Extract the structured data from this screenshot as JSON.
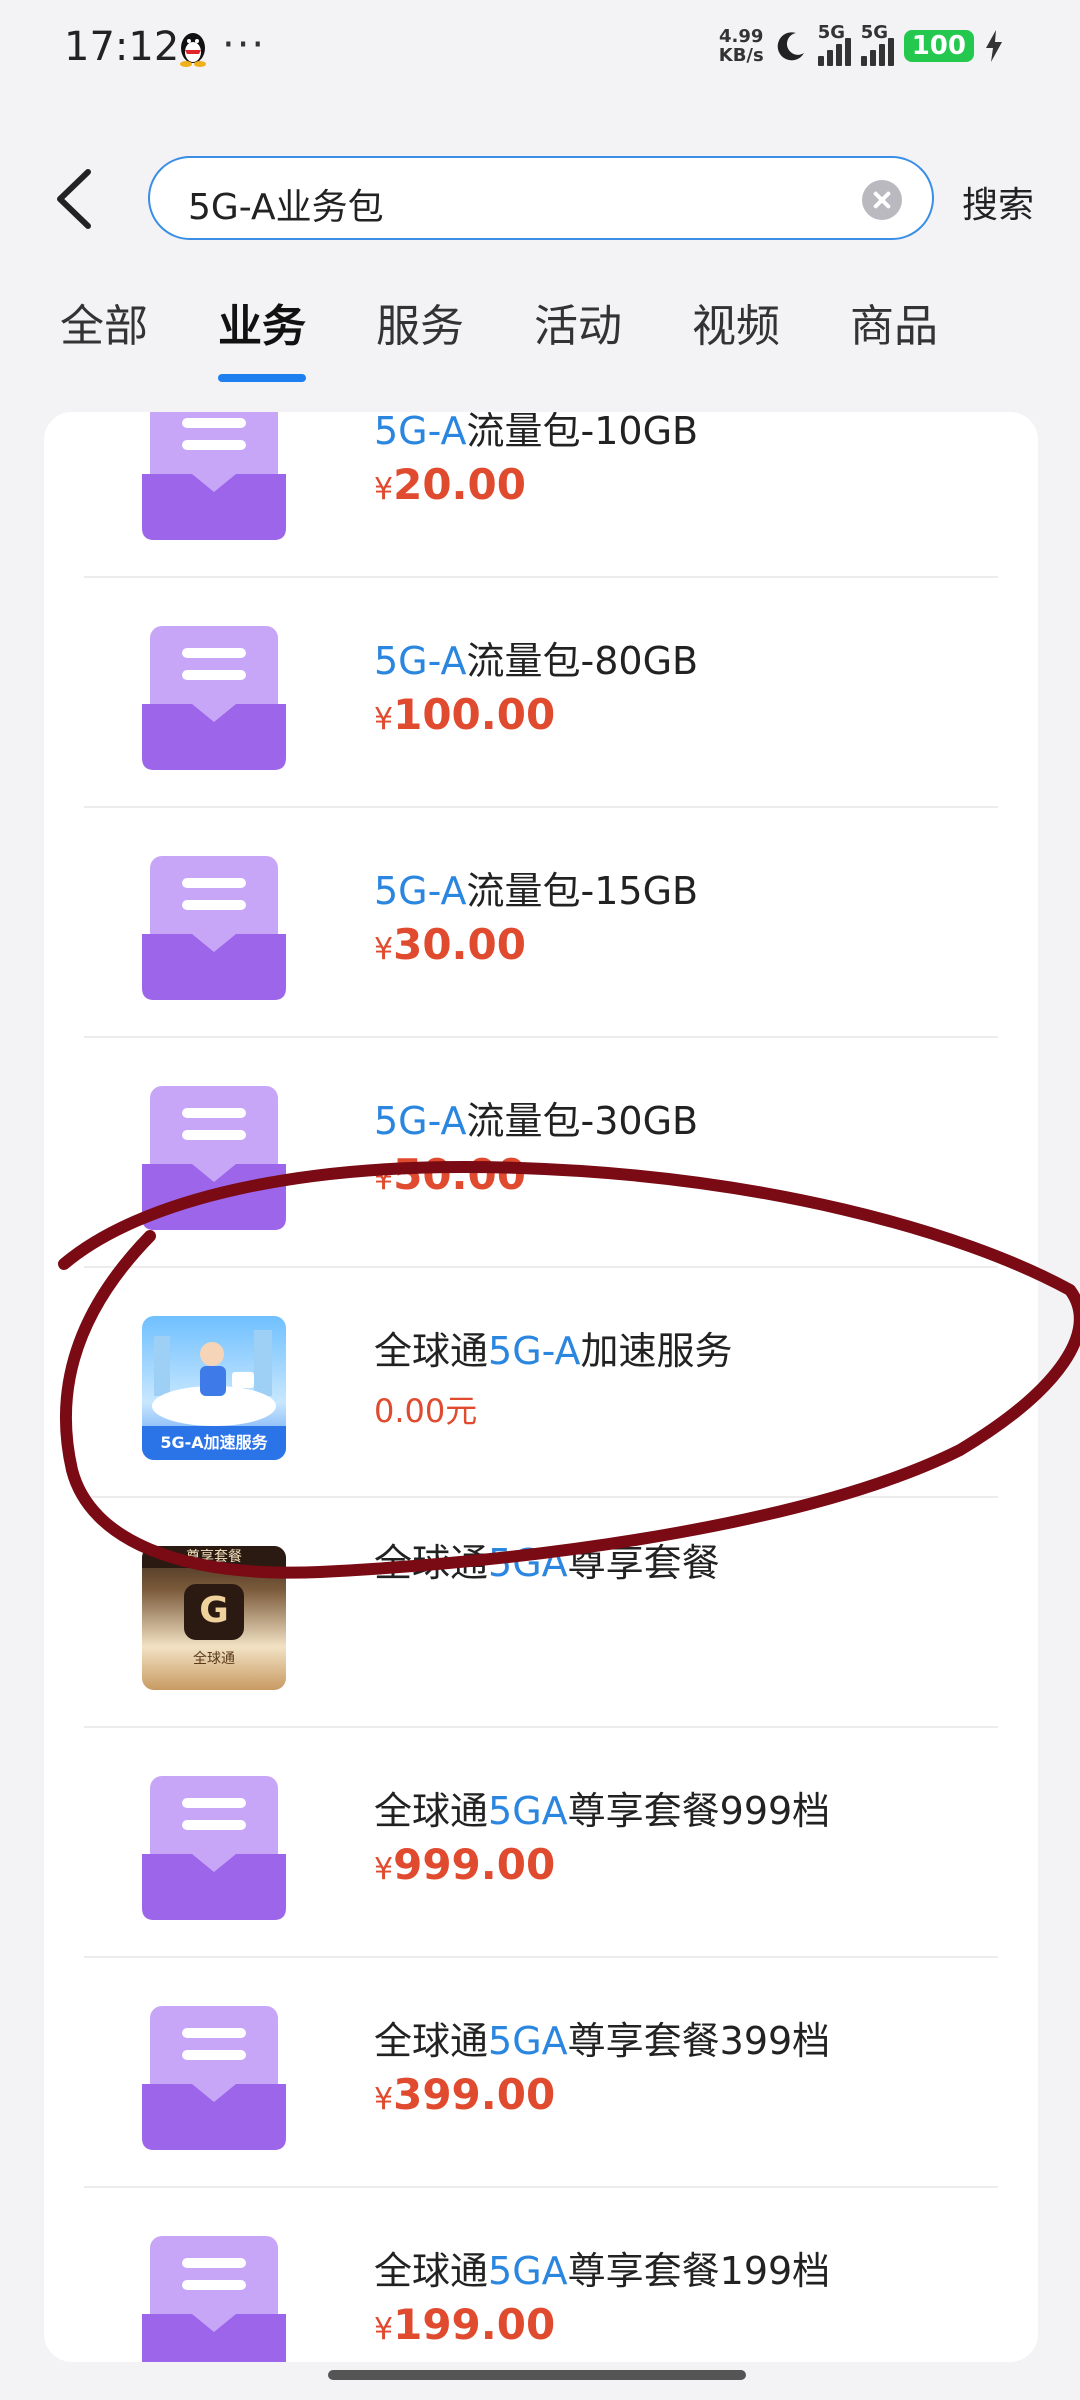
{
  "status_bar": {
    "time": "17:12",
    "speed_value": "4.99",
    "speed_unit": "KB/s",
    "sim1": "5G",
    "sim2": "5G",
    "battery": "100"
  },
  "search": {
    "query": "5G-A业务包",
    "button": "搜索"
  },
  "tabs": [
    "全部",
    "业务",
    "服务",
    "活动",
    "视频",
    "商品"
  ],
  "active_tab": "业务",
  "results": [
    {
      "title_hl": "5G-A",
      "title_rest": "流量包-10GB",
      "currency": "¥",
      "price": "20.00"
    },
    {
      "title_hl": "5G-A",
      "title_rest": "流量包-80GB",
      "currency": "¥",
      "price": "100.00"
    },
    {
      "title_hl": "5G-A",
      "title_rest": "流量包-15GB",
      "currency": "¥",
      "price": "30.00"
    },
    {
      "title_hl": "5G-A",
      "title_rest": "流量包-30GB",
      "currency": "¥",
      "price": "50.00"
    },
    {
      "title_pre": "全球通",
      "title_hl": "5G-A",
      "title_rest": "加速服务",
      "price_text": "0.00元",
      "image_caption": "5G-A加速服务"
    },
    {
      "title_pre": "全球通",
      "title_hl": "5GA",
      "title_rest": "尊享套餐",
      "image_top": "尊享套餐",
      "image_label": "全球通"
    },
    {
      "title_pre": "全球通",
      "title_hl": "5GA",
      "title_rest": "尊享套餐999档",
      "currency": "¥",
      "price": "999.00"
    },
    {
      "title_pre": "全球通",
      "title_hl": "5GA",
      "title_rest": "尊享套餐399档",
      "currency": "¥",
      "price": "399.00"
    },
    {
      "title_pre": "全球通",
      "title_hl": "5GA",
      "title_rest": "尊享套餐199档",
      "currency": "¥",
      "price": "199.00"
    }
  ],
  "colors": {
    "accent": "#1e7ff0",
    "highlight": "#2b86e0",
    "price": "#e04a2e",
    "annotation": "#7a0a14"
  }
}
